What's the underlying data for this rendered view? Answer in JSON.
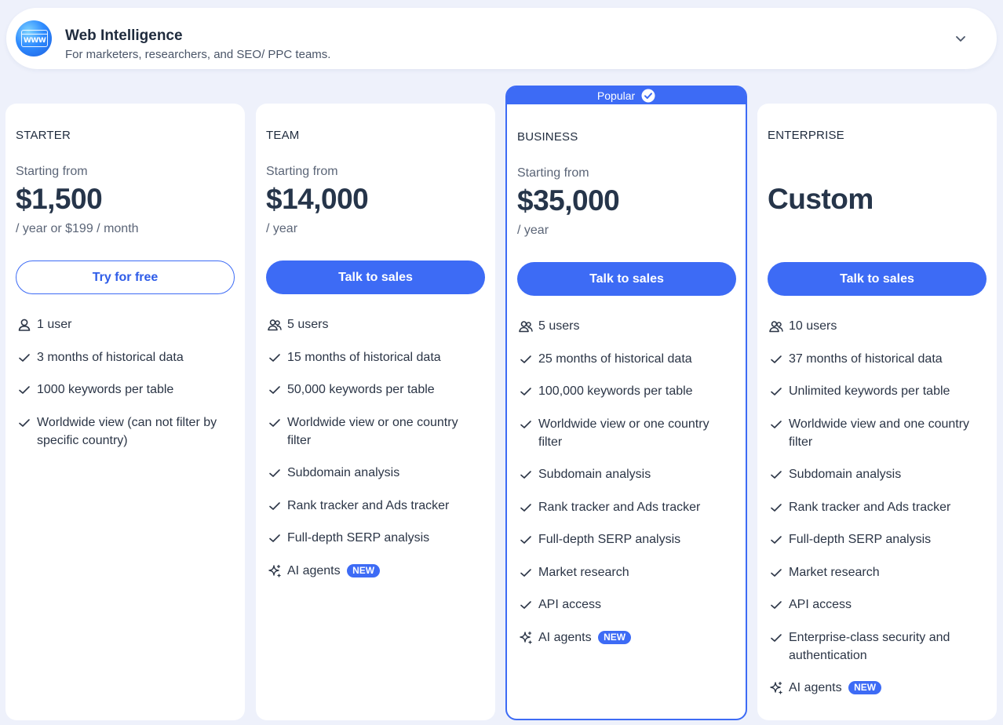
{
  "header": {
    "title": "Web Intelligence",
    "subtitle": "For marketers, researchers, and SEO/ PPC teams.",
    "logo_text": "WWW",
    "expand_icon": "chevron-down-icon"
  },
  "popular_label": "Popular",
  "plans": [
    {
      "name": "STARTER",
      "starting_from": "Starting from",
      "price": "$1,500",
      "period": "/ year or $199 / month",
      "cta": "Try for free",
      "users": "1 user",
      "features": [
        "3 months of historical data",
        "1000 keywords per table",
        "Worldwide view (can not filter by specific country)"
      ]
    },
    {
      "name": "TEAM",
      "starting_from": "Starting from",
      "price": "$14,000",
      "period": "/ year",
      "cta": "Talk to sales",
      "users": "5 users",
      "features": [
        "15 months of historical data",
        "50,000 keywords per table",
        "Worldwide view or one country filter",
        "Subdomain analysis",
        "Rank tracker and Ads tracker",
        "Full-depth SERP analysis"
      ],
      "ai_agents": "AI agents",
      "new_badge": "NEW"
    },
    {
      "name": "BUSINESS",
      "starting_from": "Starting from",
      "price": "$35,000",
      "period": "/ year",
      "cta": "Talk to sales",
      "users": "5 users",
      "features": [
        "25 months of historical data",
        "100,000 keywords per table",
        "Worldwide view or one country filter",
        "Subdomain analysis",
        "Rank tracker and Ads tracker",
        "Full-depth SERP analysis",
        "Market research",
        "API access"
      ],
      "ai_agents": "AI agents",
      "new_badge": "NEW"
    },
    {
      "name": "ENTERPRISE",
      "price": "Custom",
      "cta": "Talk to sales",
      "users": "10 users",
      "features": [
        "37 months of historical data",
        "Unlimited keywords per table",
        "Worldwide view and one country filter",
        "Subdomain analysis",
        "Rank tracker and Ads tracker",
        "Full-depth SERP analysis",
        "Market research",
        "API access",
        "Enterprise-class security and authentication"
      ],
      "ai_agents": "AI agents",
      "new_badge": "NEW"
    }
  ],
  "colors": {
    "accent": "#3d6bf5",
    "background": "#eef1fb",
    "card": "#ffffff",
    "text": "#1f2b3d"
  }
}
